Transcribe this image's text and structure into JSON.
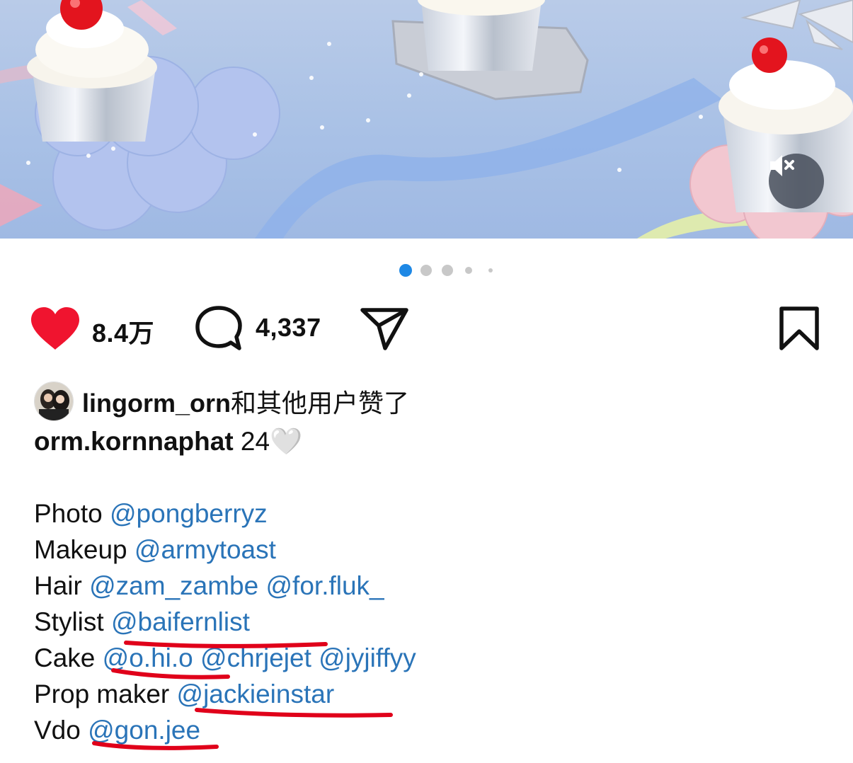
{
  "post": {
    "likes_count": "8.4万",
    "comments_count": "4,337",
    "carousel": {
      "total": 5,
      "active_index": 0
    },
    "colors": {
      "like": "#f0142f",
      "mention": "#2a74b8",
      "active_dot": "#1e88e5",
      "annotation": "#e0001a"
    }
  },
  "liked_by": {
    "user": "lingorm_orn",
    "suffix": "和其他用户赞了"
  },
  "caption": {
    "author": "orm.kornnaphat",
    "text": "24🤍",
    "credits": [
      {
        "label": "Photo",
        "mentions": [
          "@pongberryz"
        ]
      },
      {
        "label": "Makeup",
        "mentions": [
          "@armytoast"
        ]
      },
      {
        "label": "Hair",
        "mentions": [
          "@zam_zambe",
          "@for.fluk_"
        ]
      },
      {
        "label": "Stylist",
        "mentions": [
          "@baifernlist"
        ]
      },
      {
        "label": "Cake ",
        "mentions": [
          "@o.hi.o",
          "@chrjejet",
          "@jyjiffyy"
        ]
      },
      {
        "label": "Prop maker",
        "mentions": [
          "@jackieinstar"
        ]
      },
      {
        "label": "Vdo",
        "mentions": [
          "@gon.jee"
        ]
      }
    ]
  },
  "icons": {
    "like": "heart-filled-icon",
    "comment": "speech-bubble-icon",
    "share": "paper-plane-icon",
    "save": "bookmark-icon",
    "mute": "speaker-muted-icon"
  }
}
